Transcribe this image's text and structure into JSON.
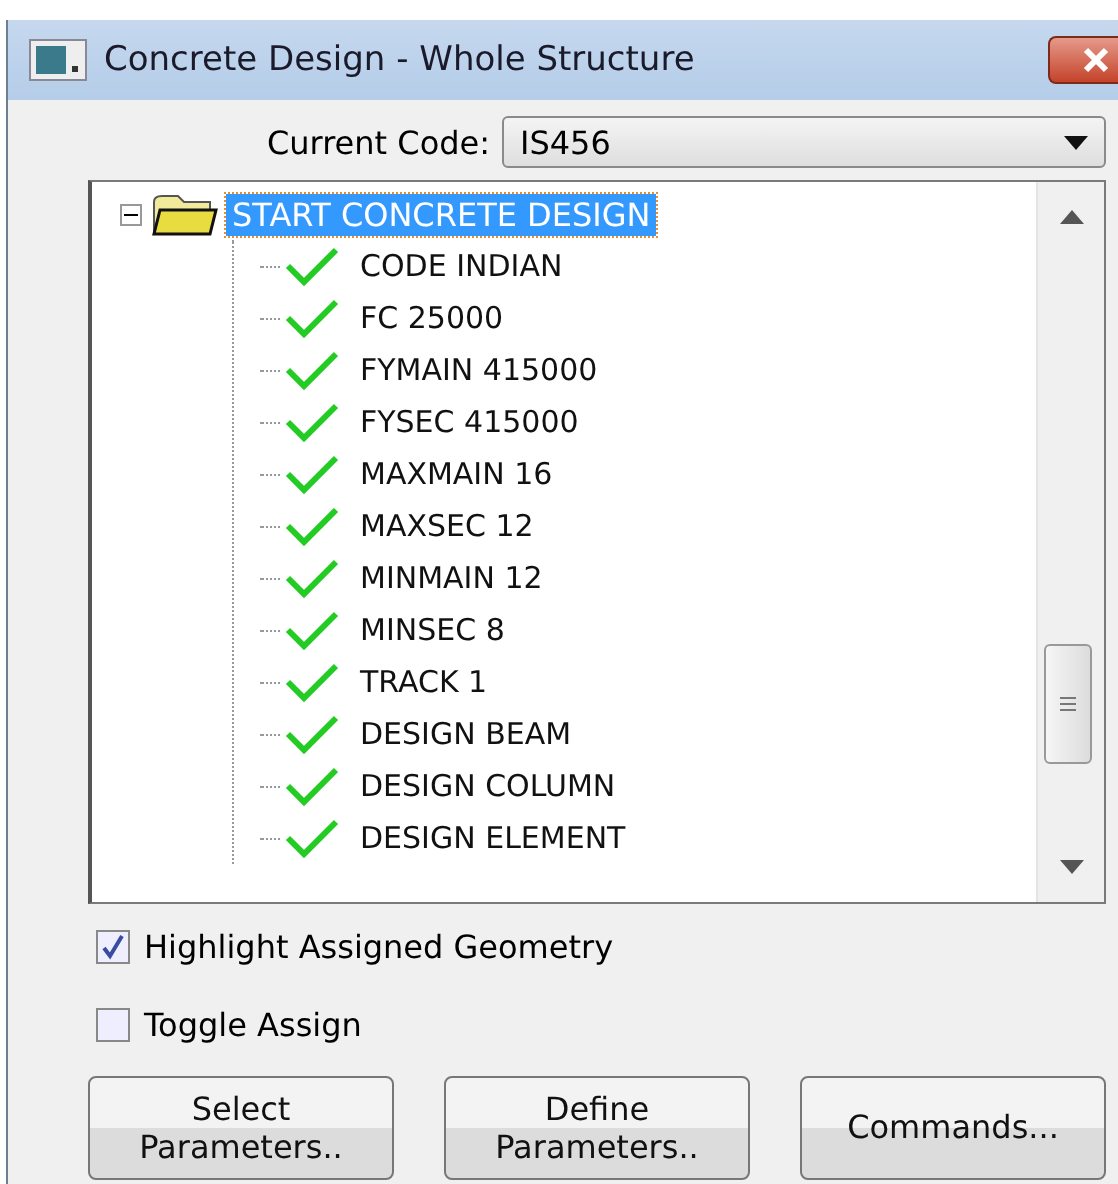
{
  "window": {
    "title": "Concrete Design - Whole Structure"
  },
  "code_selector": {
    "label": "Current Code:",
    "value": "IS456"
  },
  "tree": {
    "root": {
      "label": "START CONCRETE DESIGN",
      "selected": true,
      "expanded": true,
      "children": [
        {
          "label": "CODE INDIAN",
          "assigned": true
        },
        {
          "label": "FC 25000",
          "assigned": true
        },
        {
          "label": "FYMAIN 415000",
          "assigned": true
        },
        {
          "label": "FYSEC 415000",
          "assigned": true
        },
        {
          "label": "MAXMAIN 16",
          "assigned": true
        },
        {
          "label": "MAXSEC 12",
          "assigned": true
        },
        {
          "label": "MINMAIN 12",
          "assigned": true
        },
        {
          "label": "MINSEC 8",
          "assigned": true
        },
        {
          "label": "TRACK 1",
          "assigned": true
        },
        {
          "label": "DESIGN BEAM",
          "assigned": true
        },
        {
          "label": "DESIGN COLUMN",
          "assigned": true
        },
        {
          "label": "DESIGN ELEMENT",
          "assigned": true
        }
      ]
    }
  },
  "options": [
    {
      "label": "Highlight Assigned Geometry",
      "checked": true
    },
    {
      "label": "Toggle Assign",
      "checked": false
    }
  ],
  "buttons": [
    {
      "label": "Select\nParameters.."
    },
    {
      "label": "Define\nParameters.."
    },
    {
      "label": "Commands..."
    }
  ]
}
